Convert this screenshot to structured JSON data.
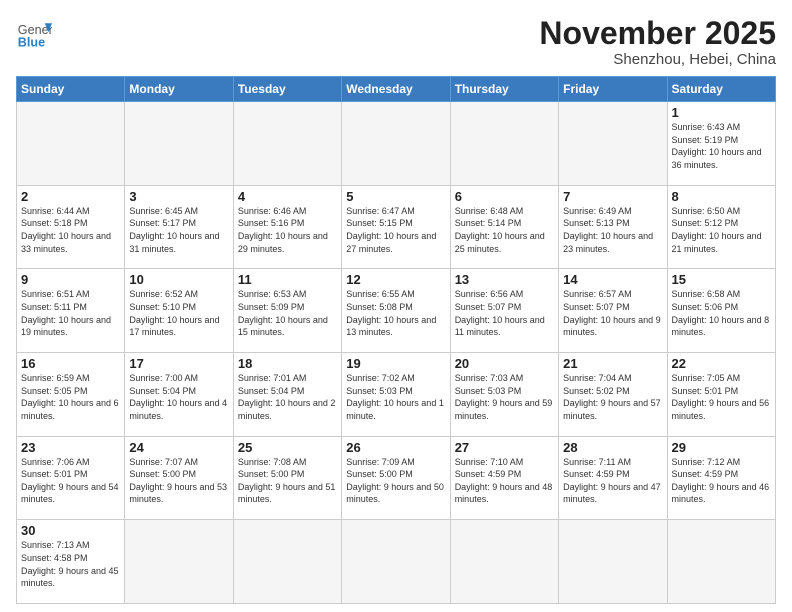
{
  "logo": {
    "general": "General",
    "blue": "Blue"
  },
  "header": {
    "month": "November 2025",
    "location": "Shenzhou, Hebei, China"
  },
  "weekdays": [
    "Sunday",
    "Monday",
    "Tuesday",
    "Wednesday",
    "Thursday",
    "Friday",
    "Saturday"
  ],
  "weeks": [
    [
      {
        "day": "",
        "info": ""
      },
      {
        "day": "",
        "info": ""
      },
      {
        "day": "",
        "info": ""
      },
      {
        "day": "",
        "info": ""
      },
      {
        "day": "",
        "info": ""
      },
      {
        "day": "",
        "info": ""
      },
      {
        "day": "1",
        "info": "Sunrise: 6:43 AM\nSunset: 5:19 PM\nDaylight: 10 hours and 36 minutes."
      }
    ],
    [
      {
        "day": "2",
        "info": "Sunrise: 6:44 AM\nSunset: 5:18 PM\nDaylight: 10 hours and 33 minutes."
      },
      {
        "day": "3",
        "info": "Sunrise: 6:45 AM\nSunset: 5:17 PM\nDaylight: 10 hours and 31 minutes."
      },
      {
        "day": "4",
        "info": "Sunrise: 6:46 AM\nSunset: 5:16 PM\nDaylight: 10 hours and 29 minutes."
      },
      {
        "day": "5",
        "info": "Sunrise: 6:47 AM\nSunset: 5:15 PM\nDaylight: 10 hours and 27 minutes."
      },
      {
        "day": "6",
        "info": "Sunrise: 6:48 AM\nSunset: 5:14 PM\nDaylight: 10 hours and 25 minutes."
      },
      {
        "day": "7",
        "info": "Sunrise: 6:49 AM\nSunset: 5:13 PM\nDaylight: 10 hours and 23 minutes."
      },
      {
        "day": "8",
        "info": "Sunrise: 6:50 AM\nSunset: 5:12 PM\nDaylight: 10 hours and 21 minutes."
      }
    ],
    [
      {
        "day": "9",
        "info": "Sunrise: 6:51 AM\nSunset: 5:11 PM\nDaylight: 10 hours and 19 minutes."
      },
      {
        "day": "10",
        "info": "Sunrise: 6:52 AM\nSunset: 5:10 PM\nDaylight: 10 hours and 17 minutes."
      },
      {
        "day": "11",
        "info": "Sunrise: 6:53 AM\nSunset: 5:09 PM\nDaylight: 10 hours and 15 minutes."
      },
      {
        "day": "12",
        "info": "Sunrise: 6:55 AM\nSunset: 5:08 PM\nDaylight: 10 hours and 13 minutes."
      },
      {
        "day": "13",
        "info": "Sunrise: 6:56 AM\nSunset: 5:07 PM\nDaylight: 10 hours and 11 minutes."
      },
      {
        "day": "14",
        "info": "Sunrise: 6:57 AM\nSunset: 5:07 PM\nDaylight: 10 hours and 9 minutes."
      },
      {
        "day": "15",
        "info": "Sunrise: 6:58 AM\nSunset: 5:06 PM\nDaylight: 10 hours and 8 minutes."
      }
    ],
    [
      {
        "day": "16",
        "info": "Sunrise: 6:59 AM\nSunset: 5:05 PM\nDaylight: 10 hours and 6 minutes."
      },
      {
        "day": "17",
        "info": "Sunrise: 7:00 AM\nSunset: 5:04 PM\nDaylight: 10 hours and 4 minutes."
      },
      {
        "day": "18",
        "info": "Sunrise: 7:01 AM\nSunset: 5:04 PM\nDaylight: 10 hours and 2 minutes."
      },
      {
        "day": "19",
        "info": "Sunrise: 7:02 AM\nSunset: 5:03 PM\nDaylight: 10 hours and 1 minute."
      },
      {
        "day": "20",
        "info": "Sunrise: 7:03 AM\nSunset: 5:03 PM\nDaylight: 9 hours and 59 minutes."
      },
      {
        "day": "21",
        "info": "Sunrise: 7:04 AM\nSunset: 5:02 PM\nDaylight: 9 hours and 57 minutes."
      },
      {
        "day": "22",
        "info": "Sunrise: 7:05 AM\nSunset: 5:01 PM\nDaylight: 9 hours and 56 minutes."
      }
    ],
    [
      {
        "day": "23",
        "info": "Sunrise: 7:06 AM\nSunset: 5:01 PM\nDaylight: 9 hours and 54 minutes."
      },
      {
        "day": "24",
        "info": "Sunrise: 7:07 AM\nSunset: 5:00 PM\nDaylight: 9 hours and 53 minutes."
      },
      {
        "day": "25",
        "info": "Sunrise: 7:08 AM\nSunset: 5:00 PM\nDaylight: 9 hours and 51 minutes."
      },
      {
        "day": "26",
        "info": "Sunrise: 7:09 AM\nSunset: 5:00 PM\nDaylight: 9 hours and 50 minutes."
      },
      {
        "day": "27",
        "info": "Sunrise: 7:10 AM\nSunset: 4:59 PM\nDaylight: 9 hours and 48 minutes."
      },
      {
        "day": "28",
        "info": "Sunrise: 7:11 AM\nSunset: 4:59 PM\nDaylight: 9 hours and 47 minutes."
      },
      {
        "day": "29",
        "info": "Sunrise: 7:12 AM\nSunset: 4:59 PM\nDaylight: 9 hours and 46 minutes."
      }
    ],
    [
      {
        "day": "30",
        "info": "Sunrise: 7:13 AM\nSunset: 4:58 PM\nDaylight: 9 hours and 45 minutes."
      },
      {
        "day": "",
        "info": ""
      },
      {
        "day": "",
        "info": ""
      },
      {
        "day": "",
        "info": ""
      },
      {
        "day": "",
        "info": ""
      },
      {
        "day": "",
        "info": ""
      },
      {
        "day": "",
        "info": ""
      }
    ]
  ]
}
